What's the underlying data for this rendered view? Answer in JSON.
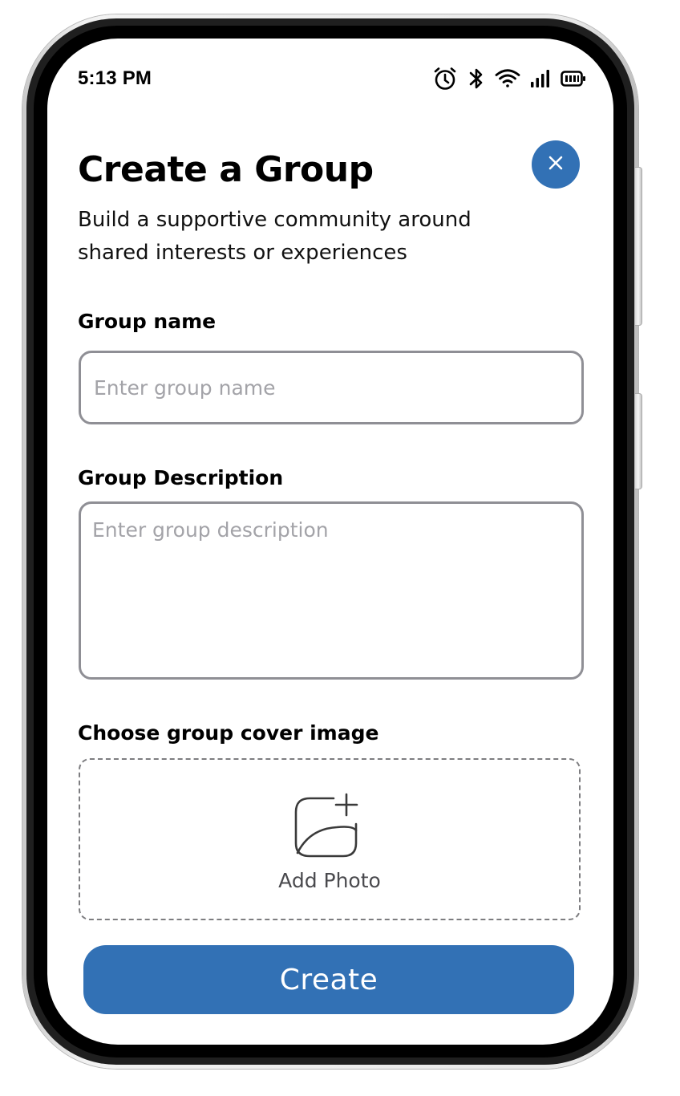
{
  "status_bar": {
    "time": "5:13 PM",
    "icons": [
      "alarm-icon",
      "bluetooth-icon",
      "wifi-icon",
      "signal-icon",
      "battery-icon"
    ]
  },
  "header": {
    "title": "Create a Group",
    "subtitle": "Build a supportive community around shared interests or experiences",
    "close_icon": "close-icon"
  },
  "form": {
    "name_label": "Group name",
    "name_placeholder": "Enter group name",
    "description_label": "Group Description",
    "description_placeholder": "Enter group description",
    "cover_label": "Choose group cover image",
    "add_photo_label": "Add Photo",
    "add_photo_icon": "add-photo-icon"
  },
  "actions": {
    "create_label": "Create"
  },
  "colors": {
    "accent": "#3271b5",
    "input_border": "#8f8f95",
    "placeholder": "#a3a3a8"
  }
}
